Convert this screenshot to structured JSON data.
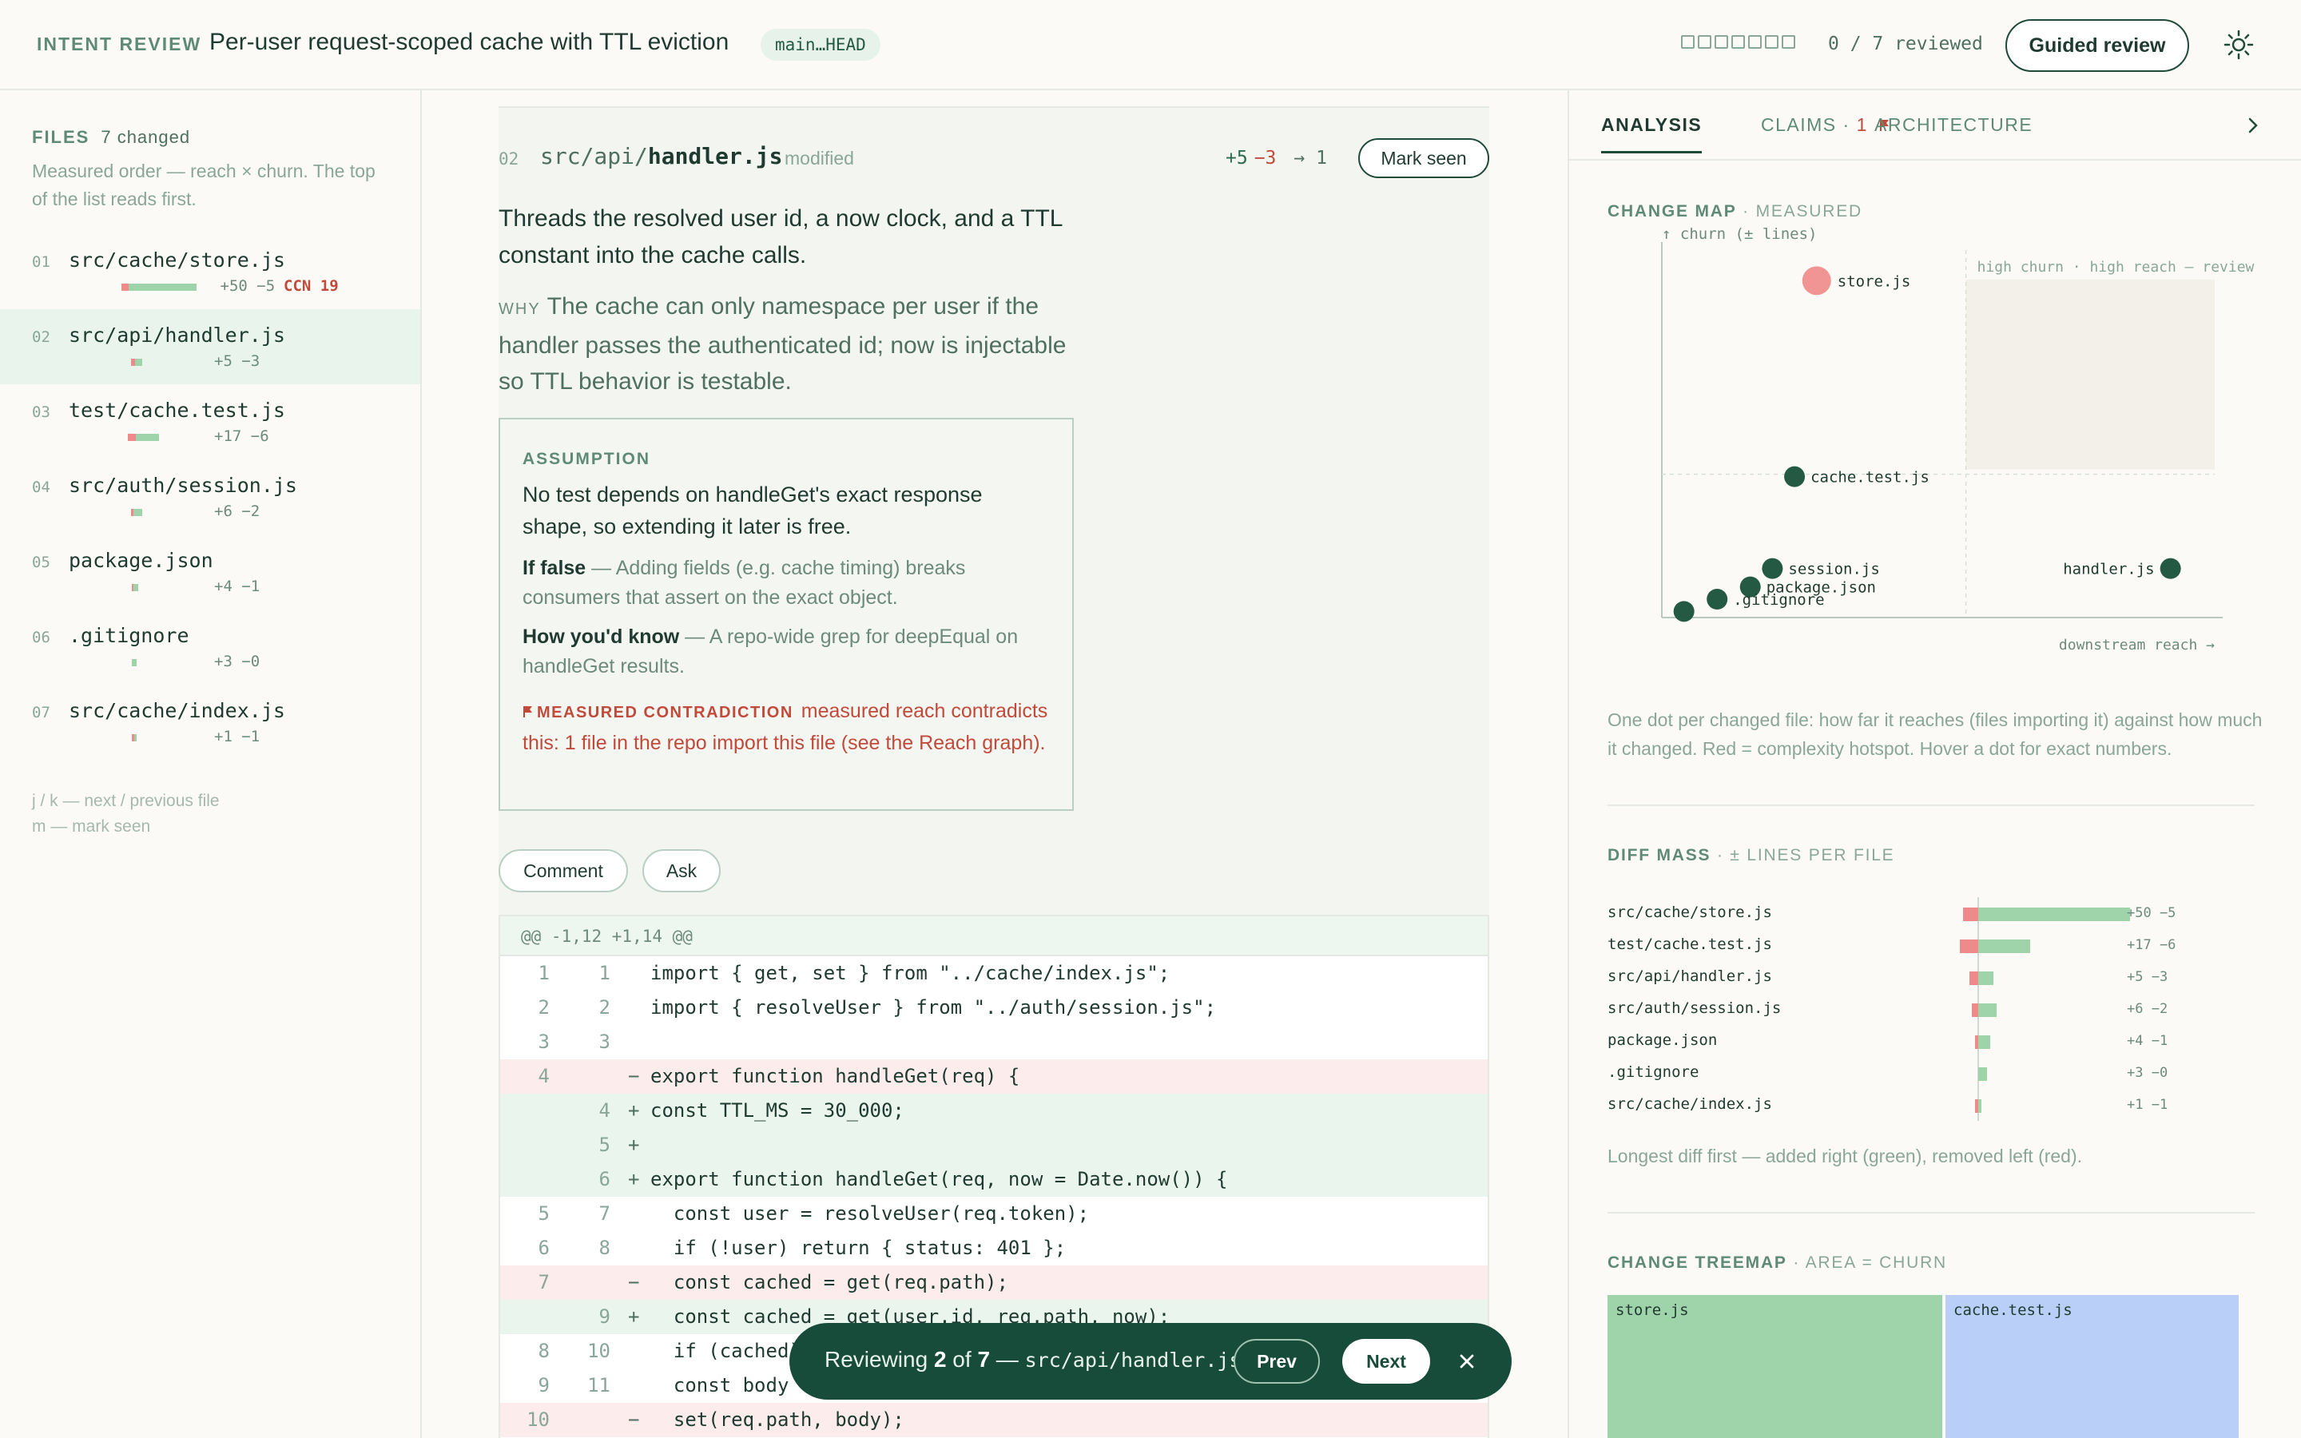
{
  "header": {
    "tag": "INTENT REVIEW",
    "title": "Per-user request-scoped cache with TTL eviction",
    "branch": "main…HEAD",
    "progress_count": "0 / 7 reviewed",
    "reviewed_fraction": 0,
    "guided_label": "Guided review"
  },
  "sidebar": {
    "heading": "FILES",
    "changed": "7 changed",
    "description": "Measured order — reach × churn. The top of the list reads first.",
    "files": [
      {
        "num": "01",
        "name": "src/cache/store.js",
        "stat": "+50 −5",
        "ccn": "CCN 19",
        "added": 50,
        "removed": 5
      },
      {
        "num": "02",
        "name": "src/api/handler.js",
        "stat": "+5 −3",
        "ccn": "",
        "added": 5,
        "removed": 3
      },
      {
        "num": "03",
        "name": "test/cache.test.js",
        "stat": "+17 −6",
        "ccn": "",
        "added": 17,
        "removed": 6
      },
      {
        "num": "04",
        "name": "src/auth/session.js",
        "stat": "+6 −2",
        "ccn": "",
        "added": 6,
        "removed": 2
      },
      {
        "num": "05",
        "name": "package.json",
        "stat": "+4 −1",
        "ccn": "",
        "added": 4,
        "removed": 1
      },
      {
        "num": "06",
        "name": ".gitignore",
        "stat": "+3 −0",
        "ccn": "",
        "added": 3,
        "removed": 0
      },
      {
        "num": "07",
        "name": "src/cache/index.js",
        "stat": "+1 −1",
        "ccn": "",
        "added": 1,
        "removed": 1
      }
    ],
    "keys_1": "j / k — next / previous file",
    "keys_2": "m — mark seen"
  },
  "review": {
    "file_num": "02",
    "path_dir": "src/api/",
    "path_file": "handler.js",
    "status": "modified",
    "stat_add": "+5",
    "stat_del": "−3",
    "stat_reach": "→ 1",
    "mark_seen": "Mark seen",
    "lead": "Threads the resolved user id, a now clock, and a TTL constant into the cache calls.",
    "why_label": "WHY",
    "why": "The cache can only namespace per user if the handler passes the authenticated id; now is injectable so TTL behavior is testable.",
    "assumption": {
      "heading": "ASSUMPTION",
      "text": "No test depends on handleGet's exact response shape, so extending it later is free.",
      "if_false_label": "If false",
      "if_false": " — Adding fields (e.g. cache timing) breaks consumers that assert on the exact object.",
      "how_label": "How you'd know",
      "how": " — A repo-wide grep for deepEqual on handleGet results.",
      "contradiction_label": "MEASURED CONTRADICTION",
      "contradiction": "measured reach contradicts this: 1 file in the repo import this file (see the Reach graph)."
    },
    "comment_label": "Comment",
    "ask_label": "Ask"
  },
  "diff": {
    "hunk": "@@ -1,12 +1,14 @@",
    "lines": [
      {
        "old": "1",
        "new": "1",
        "sign": "",
        "type": "ctx",
        "code": "import { get, set } from \"../cache/index.js\";"
      },
      {
        "old": "2",
        "new": "2",
        "sign": "",
        "type": "ctx",
        "code": "import { resolveUser } from \"../auth/session.js\";"
      },
      {
        "old": "3",
        "new": "3",
        "sign": "",
        "type": "ctx",
        "code": ""
      },
      {
        "old": "4",
        "new": "",
        "sign": "−",
        "type": "del",
        "code": "export function handleGet(req) {"
      },
      {
        "old": "",
        "new": "4",
        "sign": "+",
        "type": "add",
        "code": "const TTL_MS = 30_000;"
      },
      {
        "old": "",
        "new": "5",
        "sign": "+",
        "type": "add",
        "code": ""
      },
      {
        "old": "",
        "new": "6",
        "sign": "+",
        "type": "add",
        "code": "export function handleGet(req, now = Date.now()) {"
      },
      {
        "old": "5",
        "new": "7",
        "sign": "",
        "type": "ctx",
        "code": "  const user = resolveUser(req.token);"
      },
      {
        "old": "6",
        "new": "8",
        "sign": "",
        "type": "ctx",
        "code": "  if (!user) return { status: 401 };"
      },
      {
        "old": "7",
        "new": "",
        "sign": "−",
        "type": "del",
        "code": "  const cached = get(req.path);"
      },
      {
        "old": "",
        "new": "9",
        "sign": "+",
        "type": "add",
        "code": "  const cached = get(user.id, req.path, now);"
      },
      {
        "old": "8",
        "new": "10",
        "sign": "",
        "type": "ctx",
        "code": "  if (cached) return { status: 200, body: cached };"
      },
      {
        "old": "9",
        "new": "11",
        "sign": "",
        "type": "ctx",
        "code": "  const body = computeBody(req);"
      },
      {
        "old": "10",
        "new": "",
        "sign": "−",
        "type": "del",
        "code": "  set(req.path, body);"
      }
    ]
  },
  "toast": {
    "prefix": "Reviewing ",
    "current": "2",
    "of": " of ",
    "total": "7",
    "sep": " — ",
    "file": "src/api/handler.js",
    "prev_label": "Prev",
    "next_label": "Next"
  },
  "right": {
    "tabs": [
      "ANALYSIS",
      "CLAIMS · ",
      "ARCHITECTURE"
    ],
    "claims_count": "1",
    "change_map_title": "CHANGE MAP",
    "change_map_sub": " · MEASURED",
    "change_map_caption": "One dot per changed file: how far it reaches (files importing it) against how much it changed. Red = complexity hotspot. Hover a dot for exact numbers.",
    "diff_mass_title": "DIFF MASS",
    "diff_mass_sub": " · ± LINES PER FILE",
    "diff_mass_caption": "Longest diff first — added right (green), removed left (red).",
    "treemap_title": "CHANGE TREEMAP",
    "treemap_sub": " · AREA = CHURN",
    "accent_green": "#9fd3a9",
    "accent_red": "#ee8a8a",
    "accent_blue": "#b9cff7"
  },
  "chart_data": [
    {
      "type": "scatter",
      "title": "CHANGE MAP · MEASURED",
      "ylabel": "↑ churn (± lines)",
      "xlabel": "downstream reach →",
      "quadrant_label": "high churn · high reach — review",
      "points": [
        {
          "label": "store.js",
          "reach": 0.7,
          "churn": 55,
          "hotspot": true
        },
        {
          "label": "cache.test.js",
          "reach": 0.6,
          "churn": 23,
          "hotspot": false
        },
        {
          "label": "handler.js",
          "reach": 2.3,
          "churn": 8,
          "hotspot": false
        },
        {
          "label": "session.js",
          "reach": 0.5,
          "churn": 8,
          "hotspot": false
        },
        {
          "label": "package.json",
          "reach": 0.4,
          "churn": 5,
          "hotspot": false
        },
        {
          "label": ".gitignore",
          "reach": 0.25,
          "churn": 3,
          "hotspot": false
        },
        {
          "label": "",
          "reach": 0.1,
          "churn": 1,
          "hotspot": false
        }
      ]
    },
    {
      "type": "bar",
      "title": "DIFF MASS · ± LINES PER FILE",
      "categories": [
        "src/cache/store.js",
        "test/cache.test.js",
        "src/api/handler.js",
        "src/auth/session.js",
        "package.json",
        ".gitignore",
        "src/cache/index.js"
      ],
      "series": [
        {
          "name": "added",
          "values": [
            50,
            17,
            5,
            6,
            4,
            3,
            1
          ]
        },
        {
          "name": "removed",
          "values": [
            5,
            6,
            3,
            2,
            1,
            0,
            1
          ]
        }
      ],
      "labels": [
        "+50 −5",
        "+17 −6",
        "+5 −3",
        "+6 −2",
        "+4 −1",
        "+3 −0",
        "+1 −1"
      ]
    },
    {
      "type": "heatmap",
      "title": "CHANGE TREEMAP · AREA = CHURN",
      "cells": [
        {
          "label": "store.js",
          "churn": 55
        },
        {
          "label": "cache.test.js",
          "churn": 23
        }
      ]
    }
  ]
}
